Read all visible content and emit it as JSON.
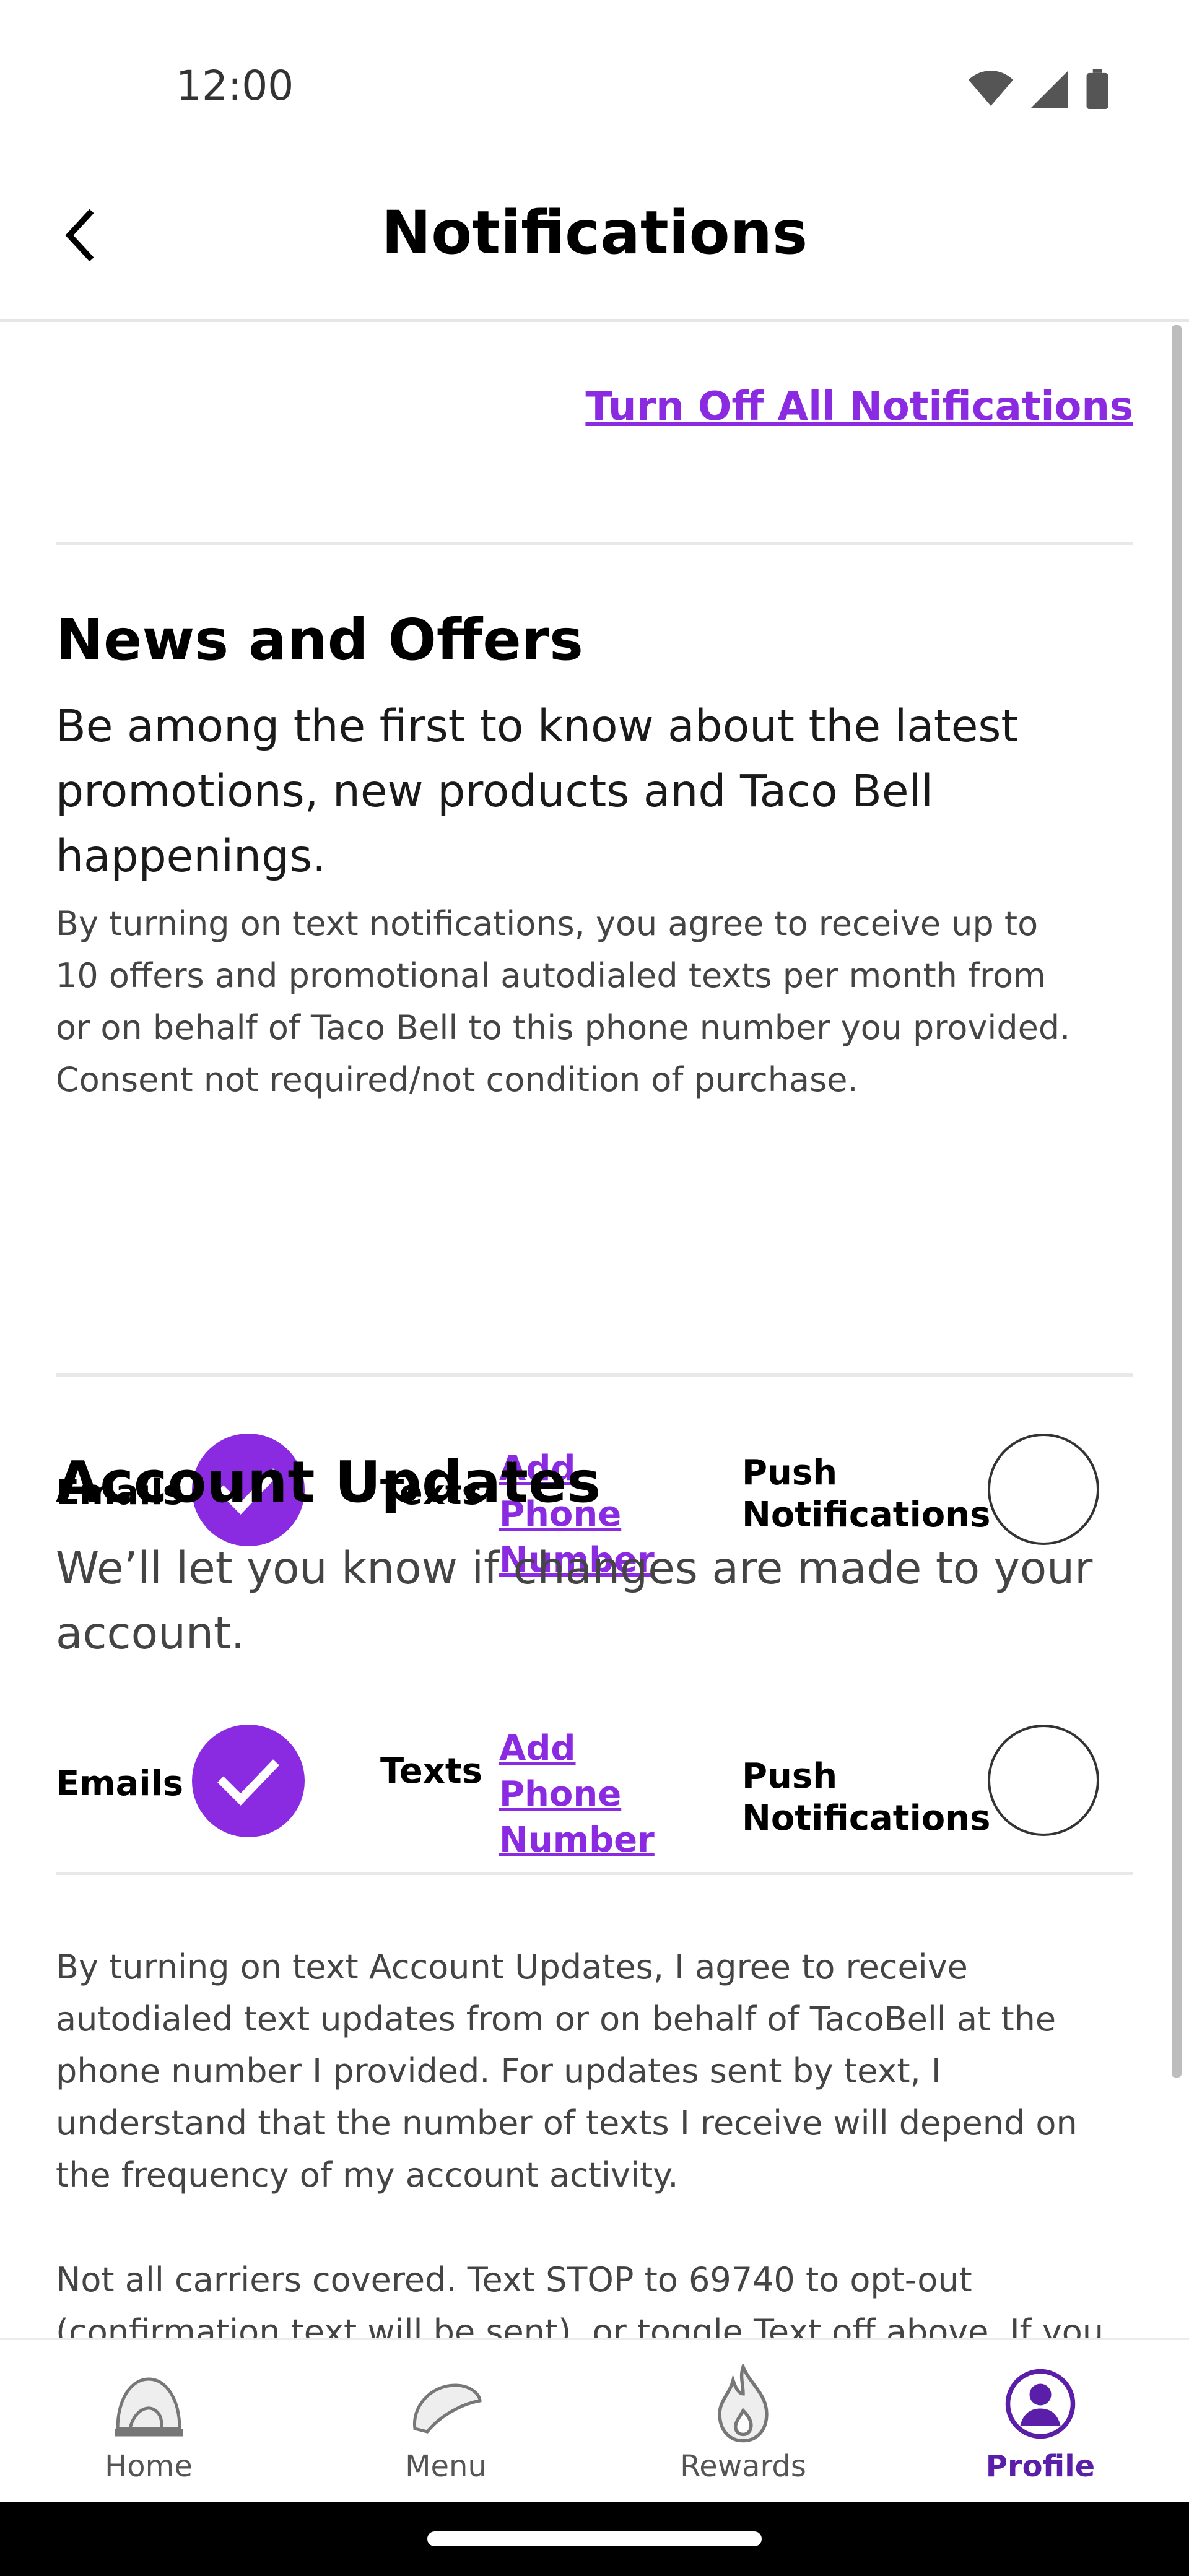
{
  "status_bar": {
    "time": "12:00",
    "icons": [
      "wifi-icon",
      "cellular-icon",
      "battery-icon"
    ]
  },
  "header": {
    "title": "Notifications",
    "back_icon": "chevron-left-icon"
  },
  "turn_off_all_label": "Turn Off All Notifications",
  "news": {
    "title": "News and Offers",
    "lead": "Be among the first to know about the latest promotions, new products and Taco Bell happenings.",
    "fine_print": "By turning on text notifications, you agree to receive up to 10 offers and promotional autodialed texts per month from or on behalf of Taco Bell to this phone number you provided. Consent not required/not condition of purchase.",
    "emails_label": "Emails",
    "emails_checked": true,
    "texts_label": "Texts",
    "add_phone_label": "Add Phone Number",
    "push_label": "Push Notifications",
    "push_checked": false
  },
  "account": {
    "title": "Account Updates",
    "lead": "We’ll let you know if changes are made to your account.",
    "emails_label": "Emails",
    "emails_checked": true,
    "texts_label": "Texts",
    "add_phone_label": "Add Phone Number",
    "push_label": "Push Notifications",
    "push_checked": false,
    "fine_print_1": "By turning on text Account Updates, I agree to receive autodialed text updates from or on behalf of TacoBell at the phone number I provided. For updates sent by text, I understand that the number of texts I receive will depend on the frequency of my account activity.",
    "fine_print_2": "Not all carriers covered. Text STOP to 69740 to opt-out (confirmation text will be sent), or toggle Text off above. If you"
  },
  "bottom_nav": {
    "items": [
      {
        "label": "Home",
        "icon": "bell-icon"
      },
      {
        "label": "Menu",
        "icon": "taco-icon"
      },
      {
        "label": "Rewards",
        "icon": "flame-icon"
      },
      {
        "label": "Profile",
        "icon": "profile-icon"
      }
    ],
    "active": "Profile"
  },
  "colors": {
    "accent": "#8a2be2",
    "active_nav": "#5b1ea8"
  }
}
